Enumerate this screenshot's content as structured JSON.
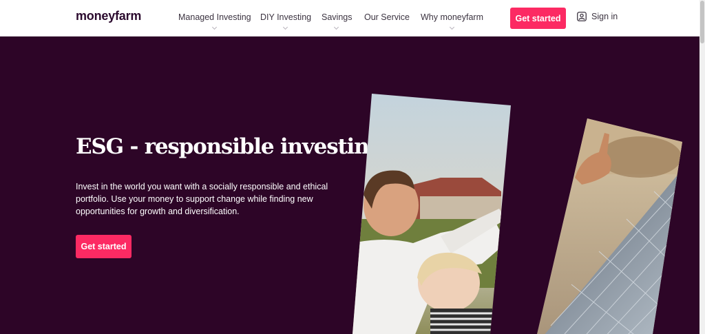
{
  "header": {
    "logo": "moneyfarm",
    "nav": [
      {
        "label": "Managed Investing",
        "has_dropdown": true
      },
      {
        "label": "DIY Investing",
        "has_dropdown": true
      },
      {
        "label": "Savings",
        "has_dropdown": true
      },
      {
        "label": "Our Service",
        "has_dropdown": false
      },
      {
        "label": "Why moneyfarm",
        "has_dropdown": true
      }
    ],
    "cta_label": "Get started",
    "signin_label": "Sign in",
    "signin_icon": "user-icon"
  },
  "hero": {
    "title": "ESG - responsible investing.",
    "description": "Invest in the world you want with a socially responsible and ethical portfolio. Use your money to support change while finding new opportunities for growth and diversification.",
    "cta_label": "Get started"
  },
  "colors": {
    "brand_dark": "#2d0527",
    "accent": "#fc2a63",
    "text_dark": "#2b0a2e"
  }
}
